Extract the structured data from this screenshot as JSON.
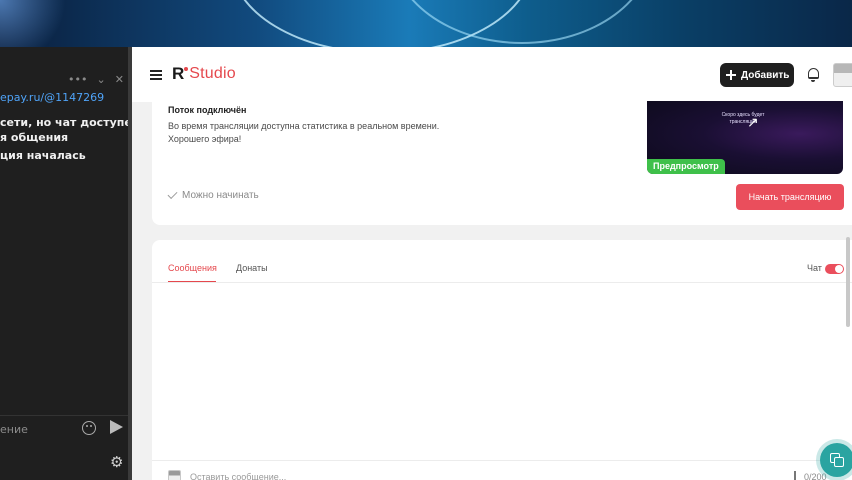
{
  "left_panel": {
    "toolbar_dots": "•••",
    "toolbar_chevron": "⌄",
    "toolbar_close": "✕",
    "link": "epay.ru/@1147269",
    "messages": [
      "сети, но чат доступен",
      "я общения",
      "ция началась"
    ],
    "input_placeholder": "ение",
    "gear": "⚙"
  },
  "header": {
    "logo_r": "R",
    "logo_studio": "Studio",
    "add_button_label": "Добавить"
  },
  "stream": {
    "status_title": "Поток подключён",
    "info_line1": "Во время трансляции доступна статистика в реальном времени.",
    "info_line2": "Хорошего эфира!",
    "preview_text": "Скоро здесь будет трансляция",
    "preview_badge": "Предпросмотр",
    "ready_label": "Можно начинать",
    "start_button_label": "Начать трансляцию"
  },
  "messages_panel": {
    "tabs": [
      {
        "label": "Сообщения",
        "active": true
      },
      {
        "label": "Донаты",
        "active": false
      }
    ],
    "chat_toggle_label": "Чат",
    "chat_enabled": true,
    "compose_placeholder": "Оставить сообщение...",
    "char_counter": "0/200"
  },
  "colors": {
    "accent": "#e5484d",
    "start_button": "#ea4e5c",
    "preview_badge": "#3fc04a",
    "help_fab": "#2aa4a1"
  }
}
